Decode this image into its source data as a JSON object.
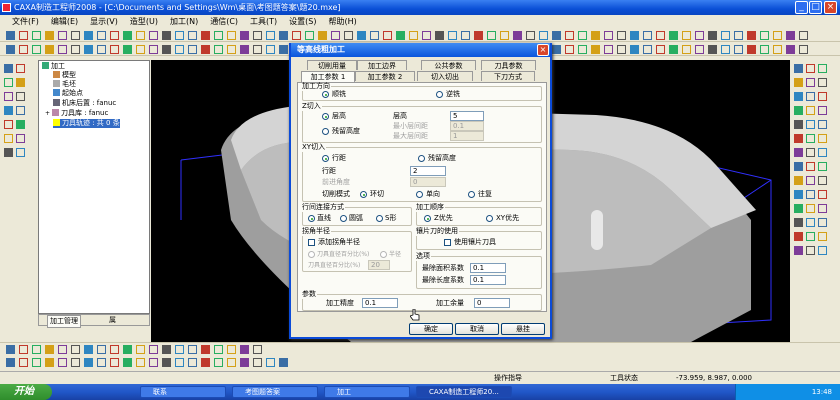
{
  "window": {
    "title": "CAXA制造工程师2008 - [C:\\Documents and Settings\\Wm\\桌面\\考图题答案\\题20.mxe]"
  },
  "menu": [
    "文件(F)",
    "编辑(E)",
    "显示(V)",
    "造型(U)",
    "加工(N)",
    "通信(C)",
    "工具(T)",
    "设置(S)",
    "帮助(H)"
  ],
  "tree": {
    "root": "加工",
    "items": [
      "模型",
      "毛坯",
      "起始点",
      "机床后置 : fanuc",
      "刀具库 : fanuc",
      "刀具轨迹 : 共 0 条"
    ],
    "tabs": [
      "加工管理",
      "属"
    ]
  },
  "dialog": {
    "title": "等高线粗加工",
    "close": "×",
    "tabs_row1": [
      "切削用量",
      "加工边界",
      "公共参数",
      "刀具参数"
    ],
    "tabs_row2": [
      "加工参数 1",
      "加工参数 2",
      "切入切出",
      "下刀方式"
    ],
    "groups": {
      "direction": {
        "title": "加工方向",
        "opt1": "顺铣",
        "opt2": "逆铣"
      },
      "z_cut": {
        "title": "Z切入",
        "opt_height": "层高",
        "opt_residual": "残留高度",
        "height_label": "层高",
        "height_value": "5",
        "min_label": "最小层间距",
        "min_value": "0.1",
        "max_label": "最大层间距",
        "max_value": "1"
      },
      "xy_cut": {
        "title": "XY切入",
        "opt_pitch": "行距",
        "opt_residual": "残留高度",
        "pitch_label": "行距",
        "pitch_value": "2",
        "angle_label": "前进角度",
        "angle_value": "0",
        "mode_label": "切削模式",
        "mode_loop": "环切",
        "mode_oneway": "单向",
        "mode_zigzag": "往复"
      },
      "link": {
        "title": "行间连接方式",
        "opt_line": "直线",
        "opt_arc": "圆弧",
        "opt_s": "S形"
      },
      "order": {
        "title": "加工顺序",
        "opt_z": "Z优先",
        "opt_xy": "XY优先"
      },
      "corner": {
        "title": "拐角半径",
        "check": "添加拐角半径",
        "opt_percent": "刀具直径百分比(%)",
        "opt_radius": "半径",
        "percent_label": "刀具直径百分比(%)",
        "percent_value": "20"
      },
      "flat": {
        "title": "镶片刀的使用",
        "check": "使用镶片刀具"
      },
      "options": {
        "title": "选项",
        "area_label": "最除面积系数",
        "area_value": "0.1",
        "length_label": "最除长度系数",
        "length_value": "0.1"
      },
      "params": {
        "title": "参数",
        "precision_label": "加工精度",
        "precision_value": "0.1",
        "allowance_label": "加工余量",
        "allowance_value": "0"
      }
    },
    "buttons": {
      "ok": "确定",
      "cancel": "取消",
      "suspend": "悬挂"
    }
  },
  "status": {
    "prompt": "操作指导",
    "tool_status": "工具状态",
    "coords": "-73.959, 8.987, 0.000"
  },
  "taskbar": {
    "start": "开始",
    "tasks": [
      "联系",
      "考图题答案",
      "加工",
      "CAXA制造工程师20..."
    ],
    "time": "13:48"
  },
  "colors": {
    "title_blue": "#0a55dc",
    "model_gray": "#c8c8c8",
    "box_blue": "#3030ff"
  }
}
